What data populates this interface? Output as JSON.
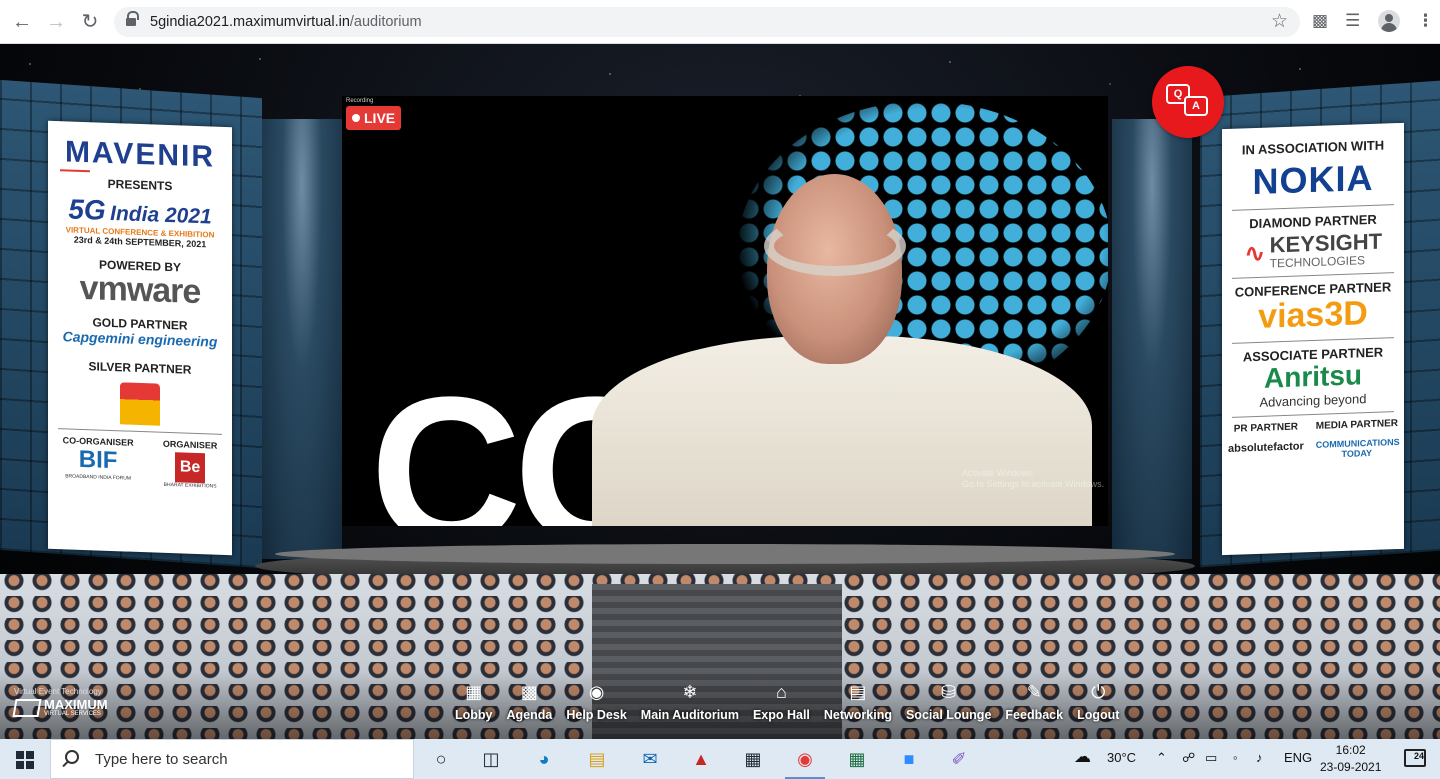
{
  "browser": {
    "url_host": "5gindia2021.maximumvirtual.in",
    "url_path": "/auditorium"
  },
  "banner_left": {
    "brand": "MAVENIR",
    "presents": "PRESENTS",
    "event_5g": "5G",
    "event_name": "India 2021",
    "subtitle": "VIRTUAL CONFERENCE & EXHIBITION",
    "dates": "23rd & 24th SEPTEMBER, 2021",
    "powered_by": "POWERED BY",
    "powered_brand": "vmware",
    "gold_label": "GOLD PARTNER",
    "gold_brand": "Capgemini engineering",
    "silver_label": "SILVER PARTNER",
    "coorg_label": "CO-ORGANISER",
    "coorg_brand": "BIF",
    "coorg_sub": "BROADBAND INDIA FORUM",
    "org_label": "ORGANISER",
    "org_brand": "Be",
    "org_sub": "BHARAT EXHIBITIONS"
  },
  "banner_right": {
    "assoc_label": "IN ASSOCIATION WITH",
    "assoc_brand": "NOKIA",
    "diamond_label": "DIAMOND PARTNER",
    "diamond_brand": "KEYSIGHT",
    "diamond_sub": "TECHNOLOGIES",
    "conf_label": "CONFERENCE PARTNER",
    "conf_brand": "vias3D",
    "associate_label": "ASSOCIATE PARTNER",
    "associate_brand": "Anritsu",
    "associate_tagline": "Advancing beyond",
    "pr_label": "PR PARTNER",
    "pr_brand": "absolutefactor",
    "media_label": "MEDIA PARTNER",
    "media_brand": "COMMUNICATIONS TODAY"
  },
  "stream": {
    "recording": "Recording",
    "live_label": "LIVE",
    "bg_text": "CO",
    "watermark_1": "Activate Windows",
    "watermark_2": "Go to Settings to activate Windows."
  },
  "qa": {
    "q": "Q",
    "a": "A"
  },
  "footer": {
    "tech_label": "Virtual Event Technology",
    "tech_brand": "MAXIMUM",
    "tech_sub": "VIRTUAL SERVICES",
    "nav": [
      {
        "label": "Lobby",
        "icon": "grid-icon"
      },
      {
        "label": "Agenda",
        "icon": "calendar-icon"
      },
      {
        "label": "Help Desk",
        "icon": "chat-icon"
      },
      {
        "label": "Main Auditorium",
        "icon": "snowflake-icon"
      },
      {
        "label": "Expo Hall",
        "icon": "building-icon"
      },
      {
        "label": "Networking",
        "icon": "card-icon"
      },
      {
        "label": "Social Lounge",
        "icon": "database-icon"
      },
      {
        "label": "Feedback",
        "icon": "edit-icon"
      },
      {
        "label": "Logout",
        "icon": "power-icon"
      }
    ]
  },
  "taskbar": {
    "search_placeholder": "Type here to search",
    "temperature": "30°C",
    "language": "ENG",
    "time": "16:02",
    "date": "23-09-2021",
    "notifications": "24"
  }
}
